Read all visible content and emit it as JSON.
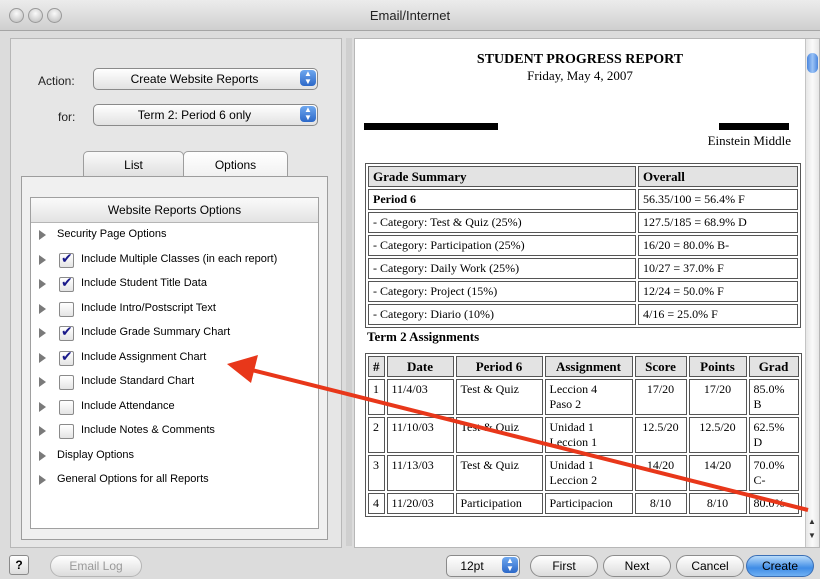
{
  "window": {
    "title": "Email/Internet"
  },
  "action": {
    "label": "Action:",
    "value": "Create Website Reports"
  },
  "for": {
    "label": "for:",
    "value": "Term 2: Period 6 only"
  },
  "tabs": [
    {
      "label": "List"
    },
    {
      "label": "Options"
    }
  ],
  "options_panel": {
    "header": "Website Reports Options",
    "rows": [
      {
        "label": "Security Page Options",
        "has_checkbox": false
      },
      {
        "label": "Include Multiple Classes (in each report)",
        "has_checkbox": true,
        "checked": true
      },
      {
        "label": "Include Student Title Data",
        "has_checkbox": true,
        "checked": true
      },
      {
        "label": "Include Intro/Postscript Text",
        "has_checkbox": true,
        "checked": false
      },
      {
        "label": "Include Grade Summary Chart",
        "has_checkbox": true,
        "checked": true
      },
      {
        "label": "Include Assignment Chart",
        "has_checkbox": true,
        "checked": true
      },
      {
        "label": "Include Standard Chart",
        "has_checkbox": true,
        "checked": false
      },
      {
        "label": "Include Attendance",
        "has_checkbox": true,
        "checked": false
      },
      {
        "label": "Include Notes & Comments",
        "has_checkbox": true,
        "checked": false
      },
      {
        "label": "Display Options",
        "has_checkbox": false
      },
      {
        "label": "General Options for all Reports",
        "has_checkbox": false
      }
    ]
  },
  "report": {
    "title": "STUDENT PROGRESS REPORT",
    "date": "Friday, May 4, 2007",
    "school": "Einstein Middle",
    "grade_summary": {
      "headers": [
        "Grade Summary",
        "Overall"
      ],
      "rows": [
        [
          "Period 6",
          "56.35/100 = 56.4%  F"
        ],
        [
          "- Category: Test & Quiz (25%)",
          "127.5/185 = 68.9%  D"
        ],
        [
          "- Category: Participation (25%)",
          "16/20 = 80.0%  B-"
        ],
        [
          "- Category: Daily Work (25%)",
          "10/27 = 37.0%  F"
        ],
        [
          "- Category: Project (15%)",
          "12/24 = 50.0%  F"
        ],
        [
          "- Category: Diario (10%)",
          "4/16 = 25.0%  F"
        ]
      ]
    },
    "assignments_title": "Term 2 Assignments",
    "assignments": {
      "headers": [
        "#",
        "Date",
        "Period 6",
        "Assignment",
        "Score",
        "Points",
        "Grad"
      ],
      "rows": [
        {
          "n": "1",
          "date": "11/4/03",
          "period": "Test & Quiz",
          "assignment": "Leccion 4",
          "assignment2": "Paso 2",
          "score": "17/20",
          "points": "17/20",
          "grade": "85.0%",
          "grade2": "B"
        },
        {
          "n": "2",
          "date": "11/10/03",
          "period": "Test & Quiz",
          "assignment": "Unidad 1",
          "assignment2": "Leccion 1",
          "score": "12.5/20",
          "points": "12.5/20",
          "grade": "62.5%",
          "grade2": "D"
        },
        {
          "n": "3",
          "date": "11/13/03",
          "period": "Test & Quiz",
          "assignment": "Unidad 1",
          "assignment2": "Leccion 2",
          "score": "14/20",
          "points": "14/20",
          "grade": "70.0%",
          "grade2": "C-"
        },
        {
          "n": "4",
          "date": "11/20/03",
          "period": "Participation",
          "assignment": "Participacion",
          "assignment2": "",
          "score": "8/10",
          "points": "8/10",
          "grade": "80.0%",
          "grade2": ""
        }
      ]
    }
  },
  "bottom": {
    "help": "?",
    "email_log": "Email Log",
    "font_size": "12pt",
    "first": "First",
    "next": "Next",
    "cancel": "Cancel",
    "create": "Create"
  },
  "colors": {
    "arrow": "#e8371a",
    "accent": "#3f8ce6"
  }
}
